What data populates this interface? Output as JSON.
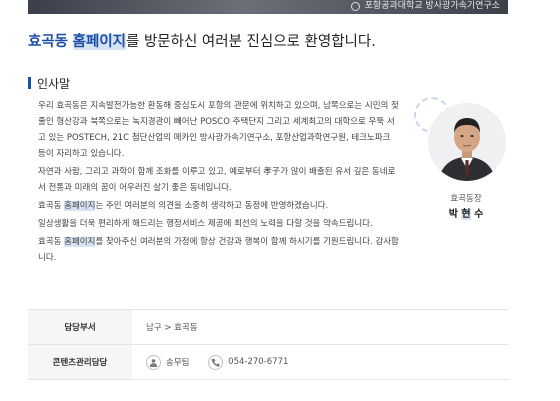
{
  "banner": {
    "caption": "포항공과대학교 방사광가속기연구소"
  },
  "welcome": {
    "town": "효곡동",
    "highlight": "홈페이지",
    "rest": "를 방문하신 여러분 진심으로 환영합니다."
  },
  "greeting": {
    "title": "인사말",
    "p1": "우리 효곡동은 지속발전가능한 환동해 중심도시 포항의 관문에 위치하고 있으며, 남쪽으로는 시민의 젖줄인 형산강과 북쪽으로는 녹지경관이 빼어난 POSCO 주택단지 그리고 세계최고의 대학으로 우뚝 서고 있는 POSTECH, 21C 첨단산업의 메카인 방사광가속기연구소, 포항산업과학연구원, 테크노파크 등이 자리하고 있습니다.",
    "p2": "자연과 사람, 그리고 과학이 함께 조화를 이루고 있고, 예로부터 孝子가 많이 배출된 유서 깊은 동네로서 전통과 미래의 꿈이 어우러진 살기 좋은 동네입니다.",
    "p3_pre": "효곡동 ",
    "p3_hl": "홈페이지",
    "p3_post": "는 주민 여러분의 의견을 소중히 생각하고 동정에 반영하겠습니다.",
    "p4": "일상생활을 더욱 편리하게 해드리는 행정서비스 제공에 최선의 노력을 다할 것을 약속드립니다.",
    "p5_pre": "효곡동 ",
    "p5_hl": "홈페이지",
    "p5_post": "를 찾아주신 여러분의 가정에 항상 건강과 행복이 함께 하시기를 기원드립니다. 감사합니다."
  },
  "head": {
    "role": "효곡동장",
    "name_first": "박",
    "name_hl": "현",
    "name_last": "수"
  },
  "info": {
    "dept_label": "담당부서",
    "dept_value": "남구 > 효곡동",
    "manager_label": "콘텐츠관리담당",
    "manager_name": "송무팀",
    "manager_phone": "054-270-6771"
  },
  "icons": {
    "person": "person-icon",
    "phone": "phone-icon"
  },
  "colors": {
    "accent": "#1c4fa6",
    "highlight": "#d6e3f4"
  }
}
